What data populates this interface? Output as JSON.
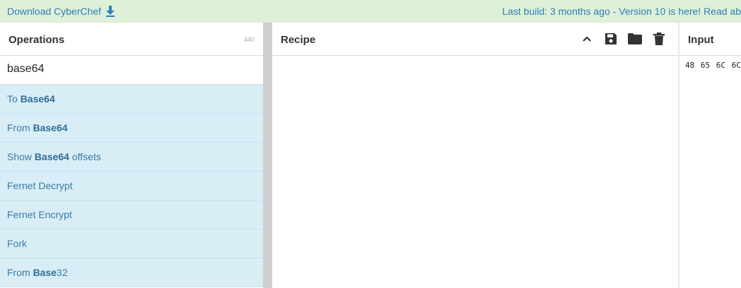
{
  "banner": {
    "download_label": "Download CyberChef",
    "build_info": "Last build: 3 months ago - Version 10 is here! Read ab"
  },
  "operations": {
    "title": "Operations",
    "count": "440",
    "search_value": "base64",
    "items": [
      {
        "pre": "To ",
        "bold": "Base64",
        "post": ""
      },
      {
        "pre": "From ",
        "bold": "Base64",
        "post": ""
      },
      {
        "pre": "Show ",
        "bold": "Base64",
        "post": " offsets"
      },
      {
        "pre": "Fernet Decrypt",
        "bold": "",
        "post": ""
      },
      {
        "pre": "Fernet Encrypt",
        "bold": "",
        "post": ""
      },
      {
        "pre": "Fork",
        "bold": "",
        "post": ""
      },
      {
        "pre": "From ",
        "bold": "Base",
        "post": "32"
      }
    ]
  },
  "recipe": {
    "title": "Recipe",
    "buttons": [
      "chevron-up-icon",
      "save-icon",
      "folder-icon",
      "trash-icon"
    ]
  },
  "input": {
    "title": "Input",
    "text": "48 65 6C 6C"
  },
  "colors": {
    "banner_bg": "#dff0d8",
    "link": "#2c7fba",
    "op_item_bg": "#d9edf7",
    "op_item_text": "#3a7ca5"
  }
}
